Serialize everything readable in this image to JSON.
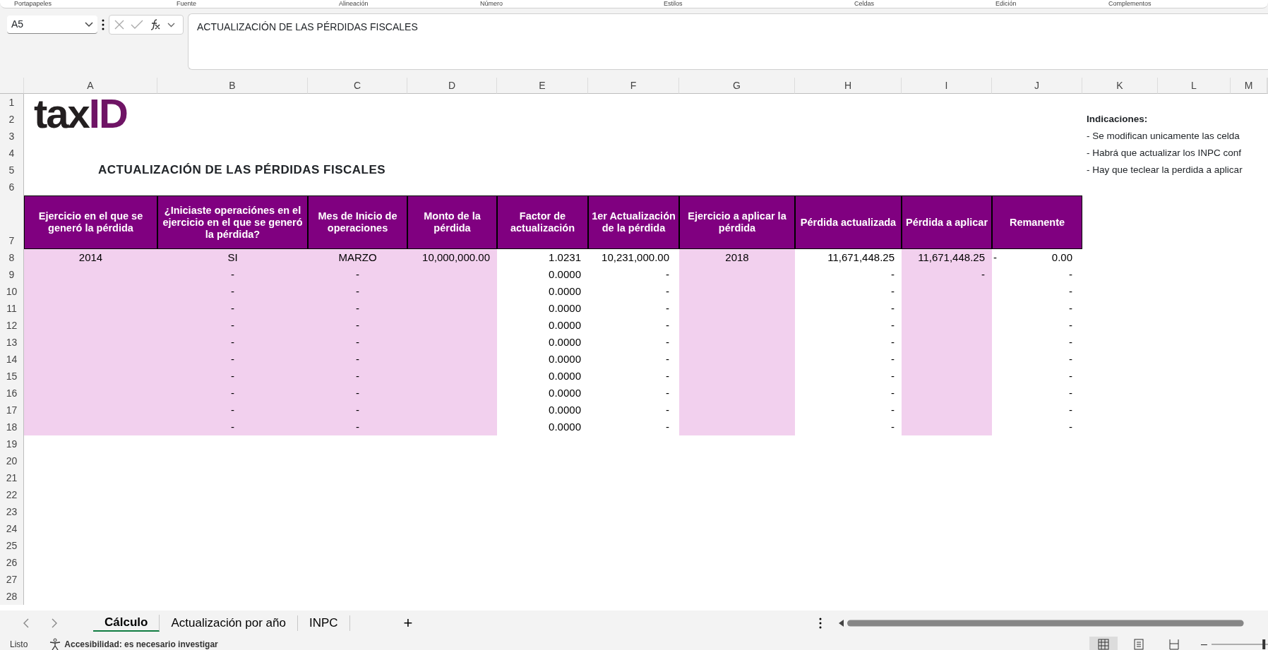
{
  "ribbon_groups": [
    "Portapapeles",
    "Fuente",
    "Alineación",
    "Número",
    "Estilos",
    "Celdas",
    "Edición",
    "Complementos"
  ],
  "formula_bar": {
    "name_box": "A5",
    "formula": "ACTUALIZACIÓN DE LAS PÉRDIDAS FISCALES"
  },
  "column_headers": [
    "A",
    "B",
    "C",
    "D",
    "E",
    "F",
    "G",
    "H",
    "I",
    "J",
    "K",
    "L",
    "M"
  ],
  "row_numbers": [
    "1",
    "2",
    "3",
    "4",
    "5",
    "6",
    "7",
    "8",
    "9",
    "10",
    "11",
    "12",
    "13",
    "14",
    "15",
    "16",
    "17",
    "18",
    "19",
    "20",
    "21",
    "22",
    "23",
    "24",
    "25",
    "26",
    "27",
    "28"
  ],
  "logo": {
    "dark": "tax",
    "accent": "ID"
  },
  "title": "ACTUALIZACIÓN DE LAS PÉRDIDAS FISCALES",
  "indications": {
    "heading": "Indicaciones:",
    "lines": [
      "- Se modifican unicamente las celda",
      "- Habrá que actualizar los INPC conf",
      "- Hay que teclear la perdida a aplicar"
    ]
  },
  "table": {
    "columns": [
      {
        "label": "Ejercicio en el que se generó la pérdida",
        "input": true
      },
      {
        "label": "¿Iniciaste operaciónes en el ejercicio en el que se generó la pérdida?",
        "input": true
      },
      {
        "label": "Mes de Inicio de operaciones",
        "input": true
      },
      {
        "label": "Monto de la pérdida",
        "input": true
      },
      {
        "label": "Factor de actualización",
        "input": false
      },
      {
        "label": "1er Actualización de la pérdida",
        "input": false
      },
      {
        "label": "Ejercicio a aplicar la pérdida",
        "input": true
      },
      {
        "label": "Pérdida actualizada",
        "input": false
      },
      {
        "label": "Pérdida a aplicar",
        "input": true
      },
      {
        "label": "Remanente",
        "input": false
      }
    ],
    "rows": [
      [
        "2014",
        "SI",
        "MARZO",
        "10,000,000.00",
        "1.0231",
        "10,231,000.00",
        "2018",
        "11,671,448.25",
        "11,671,448.25",
        [
          "-",
          "0.00"
        ]
      ],
      [
        null,
        "-",
        "-",
        null,
        "0.0000",
        "-",
        null,
        "-",
        "-",
        "-"
      ],
      [
        null,
        "-",
        "-",
        null,
        "0.0000",
        "-",
        null,
        "-",
        null,
        "-"
      ],
      [
        null,
        "-",
        "-",
        null,
        "0.0000",
        "-",
        null,
        "-",
        null,
        "-"
      ],
      [
        null,
        "-",
        "-",
        null,
        "0.0000",
        "-",
        null,
        "-",
        null,
        "-"
      ],
      [
        null,
        "-",
        "-",
        null,
        "0.0000",
        "-",
        null,
        "-",
        null,
        "-"
      ],
      [
        null,
        "-",
        "-",
        null,
        "0.0000",
        "-",
        null,
        "-",
        null,
        "-"
      ],
      [
        null,
        "-",
        "-",
        null,
        "0.0000",
        "-",
        null,
        "-",
        null,
        "-"
      ],
      [
        null,
        "-",
        "-",
        null,
        "0.0000",
        "-",
        null,
        "-",
        null,
        "-"
      ],
      [
        null,
        "-",
        "-",
        null,
        "0.0000",
        "-",
        null,
        "-",
        null,
        "-"
      ],
      [
        null,
        "-",
        "-",
        null,
        "0.0000",
        "-",
        null,
        "-",
        null,
        "-"
      ]
    ]
  },
  "sheet_tabs": [
    {
      "label": "Cálculo",
      "selected": true
    },
    {
      "label": "Actualización por año",
      "selected": false
    },
    {
      "label": "INPC",
      "selected": false
    }
  ],
  "add_sheet": "+",
  "status_bar": {
    "mode": "Listo",
    "accessibility": "Accesibilidad: es necesario investigar"
  },
  "view_buttons": [
    {
      "kind": "normal",
      "selected": true
    },
    {
      "kind": "page-layout",
      "selected": false
    },
    {
      "kind": "page-break",
      "selected": false
    }
  ],
  "zoom_out": "–",
  "zoom_slider": {
    "level": 0.95
  }
}
